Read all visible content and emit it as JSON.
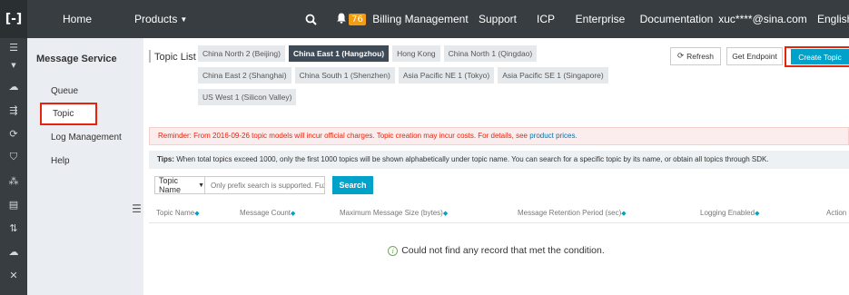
{
  "topbar": {
    "logo": "[-]",
    "home": "Home",
    "products": "Products",
    "search_icon": "search-icon",
    "bell_icon": "bell-icon",
    "notification_count": "76",
    "billing": "Billing Management",
    "support": "Support",
    "icp": "ICP",
    "enterprise": "Enterprise",
    "documentation": "Documentation",
    "user": "xuc****@sina.com",
    "language": "English"
  },
  "sidebar": {
    "title": "Message Service",
    "items": [
      {
        "label": "Queue"
      },
      {
        "label": "Topic"
      },
      {
        "label": "Log Management"
      },
      {
        "label": "Help"
      }
    ]
  },
  "main": {
    "topic_list_label": "Topic List",
    "regions": [
      [
        "China North 2 (Beijing)",
        "China East 1 (Hangzhou)",
        "Hong Kong",
        "China North 1 (Qingdao)"
      ],
      [
        "China East 2 (Shanghai)",
        "China South 1 (Shenzhen)",
        "Asia Pacific NE 1 (Tokyo)",
        "Asia Pacific SE 1 (Singapore)"
      ],
      [
        "US West 1 (Silicon Valley)"
      ]
    ],
    "active_region": "China East 1 (Hangzhou)",
    "refresh": "Refresh",
    "get_endpoint": "Get Endpoint",
    "create_topic": "Create Topic",
    "notice_text": "Reminder: From 2016-09-26 topic models will incur official charges. Topic creation may incur costs. For details, see ",
    "notice_link": "product prices",
    "notice_end": ".",
    "tips_label": "Tips:",
    "tips_text": " When total topics exceed 1000, only the first 1000 topics will be shown alphabetically under topic name. You can search for a specific topic by its name, or obtain all topics through SDK.",
    "search_field": "Topic Name",
    "search_placeholder": "Only prefix search is supported. Fuzzy search",
    "search_button": "Search",
    "columns": [
      "Topic Name",
      "Message Count",
      "Maximum Message Size (bytes)",
      "Message Retention Period (sec)",
      "Logging Enabled",
      "Action"
    ],
    "empty_message": "Could not find any record that met the condition."
  },
  "colors": {
    "topbar_bg": "#373d41",
    "accent": "#00a2ca",
    "highlight_border": "#e9230a",
    "badge": "#f39c12"
  }
}
